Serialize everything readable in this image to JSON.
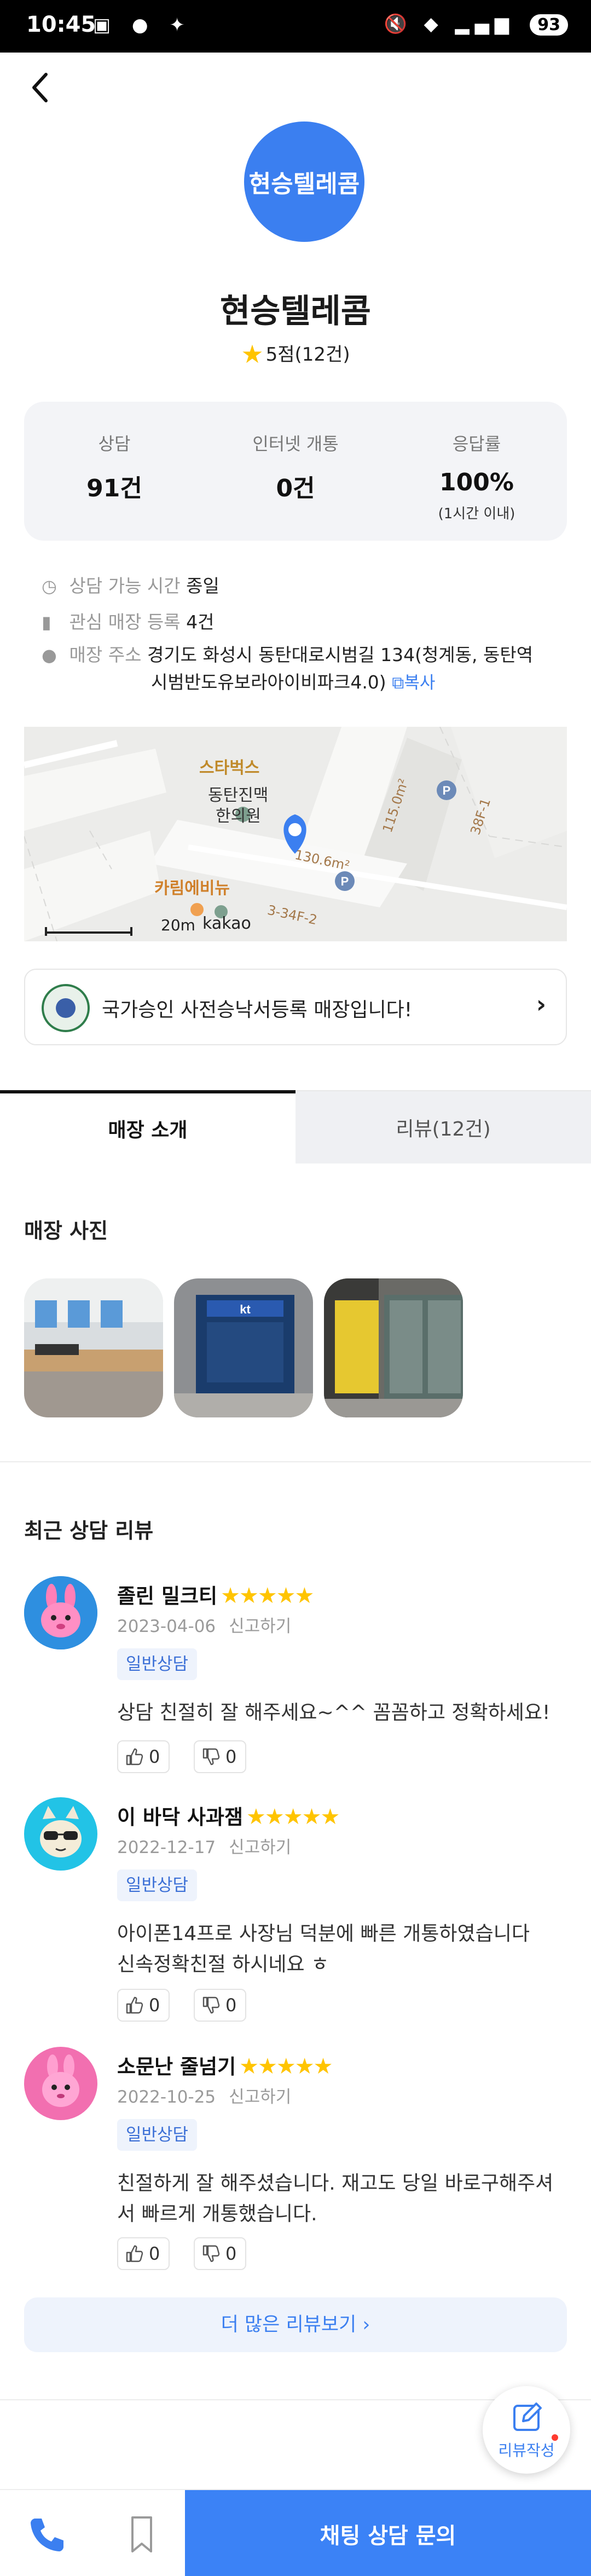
{
  "status_bar": {
    "time": "10:45",
    "notification_icons": "▣ ● ✦",
    "system_icons": "🔇 ◆ ▂▄▆",
    "battery": "93"
  },
  "store": {
    "avatar_text": "현승텔레콤",
    "name": "현승텔레콤",
    "rating": "5점(12건)"
  },
  "stats": [
    {
      "label": "상담",
      "value": "91건",
      "sub": ""
    },
    {
      "label": "인터넷 개통",
      "value": "0건",
      "sub": ""
    },
    {
      "label": "응답률",
      "value": "100%",
      "sub": "(1시간 이내)"
    }
  ],
  "info": {
    "hours_label": "상담 가능 시간",
    "hours_value": "종일",
    "fav_label": "관심 매장 등록",
    "fav_value": "4건",
    "addr_label": "매장 주소",
    "addr_line1": "경기도 화성시 동탄대로시범길 134(청계동, 동탄역",
    "addr_line2": "시범반도유보라아이비파크4.0)",
    "copy_label": "복사"
  },
  "map": {
    "label_starbucks": "스타벅스",
    "label_clinic_1": "동탄진맥",
    "label_clinic_2": "한의원",
    "label_cafe": "카림에비뉴",
    "label_115": "115.0m²",
    "label_130": "130.6m²",
    "label_38f": "38F-1",
    "label_34f": "3-34F-2",
    "scale": "20m",
    "brand": "kakao"
  },
  "certification": {
    "text": "국가승인 사전승낙서등록 매장입니다!"
  },
  "tabs": [
    {
      "label": "매장 소개",
      "active": true
    },
    {
      "label": "리뷰(12건)",
      "active": false
    }
  ],
  "photos_title": "매장 사진",
  "reviews_title": "최근 상담 리뷰",
  "reviews": [
    {
      "name": "졸린 밀크티",
      "stars": "★★★★★",
      "date": "2023-04-06",
      "report": "신고하기",
      "tag": "일반상담",
      "body": "상담 친절히 잘 해주세요~^^ 꼼꼼하고 정확하세요!",
      "likes": "0",
      "dislikes": "0"
    },
    {
      "name": "이 바닥 사과잼",
      "stars": "★★★★★",
      "date": "2022-12-17",
      "report": "신고하기",
      "tag": "일반상담",
      "body_line1": "아이폰14프로 사장님 덕분에 빠른 개통하였습니다",
      "body_line2": "신속정확친절 하시네요 ㅎ",
      "likes": "0",
      "dislikes": "0"
    },
    {
      "name": "소문난 줄넘기",
      "stars": "★★★★★",
      "date": "2022-10-25",
      "report": "신고하기",
      "tag": "일반상담",
      "body_line1": "친절하게 잘 해주셨습니다. 재고도 당일 바로구해주셔",
      "body_line2": "서 빠르게 개통했습니다.",
      "likes": "0",
      "dislikes": "0"
    }
  ],
  "more_reviews": "더 많은 리뷰보기 ›",
  "write_review": "리뷰작성",
  "chat_button": "채팅 상담 문의",
  "colors": {
    "accent": "#3b82f6",
    "star": "#ffc400",
    "tag_bg": "#eef3fc"
  }
}
